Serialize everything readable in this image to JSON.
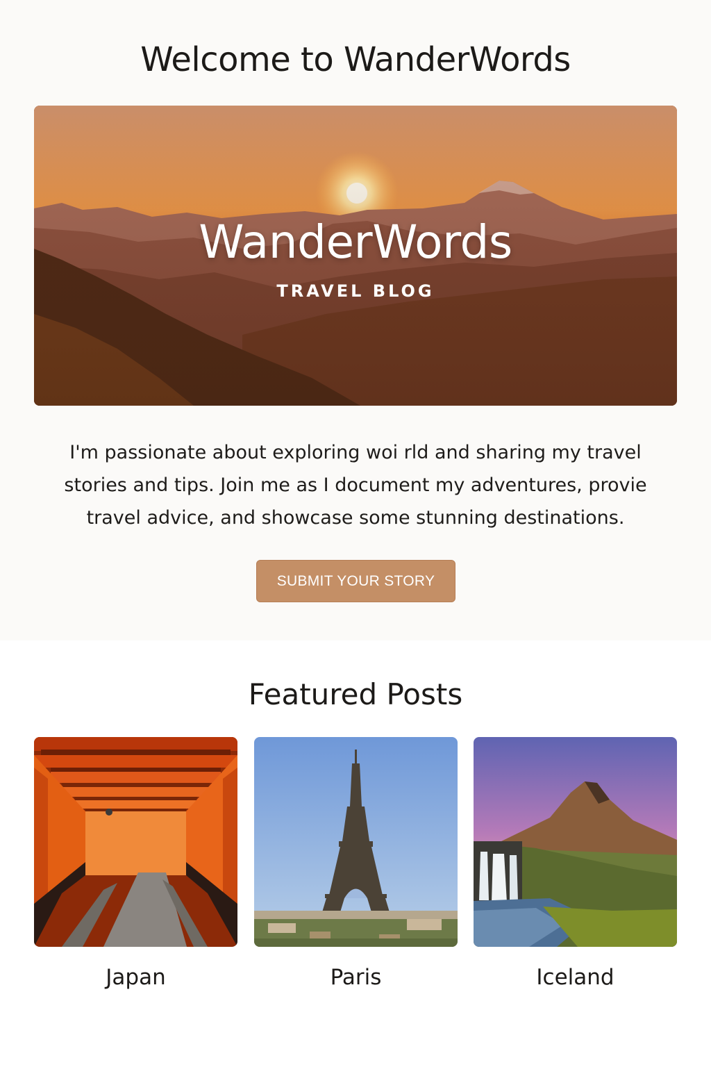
{
  "header": {
    "title": "Welcome to WanderWords"
  },
  "hero": {
    "title": "WanderWords",
    "subtitle": "TRAVEL BLOG"
  },
  "intro": {
    "lines": [
      "I'm passionate about exploring woi rld and sharing my travel",
      "stories and tips. Join me as I document my adventures, provie",
      "travel advice, and showcase some stunning destinations."
    ]
  },
  "cta": {
    "label": "SUBMIT YOUR STORY",
    "color": "#c48f66"
  },
  "featured": {
    "title": "Featured Posts",
    "posts": [
      {
        "label": "Japan",
        "image": "torii-gates-tunnel"
      },
      {
        "label": "Paris",
        "image": "eiffel-tower"
      },
      {
        "label": "Iceland",
        "image": "mountain-waterfall"
      }
    ]
  }
}
